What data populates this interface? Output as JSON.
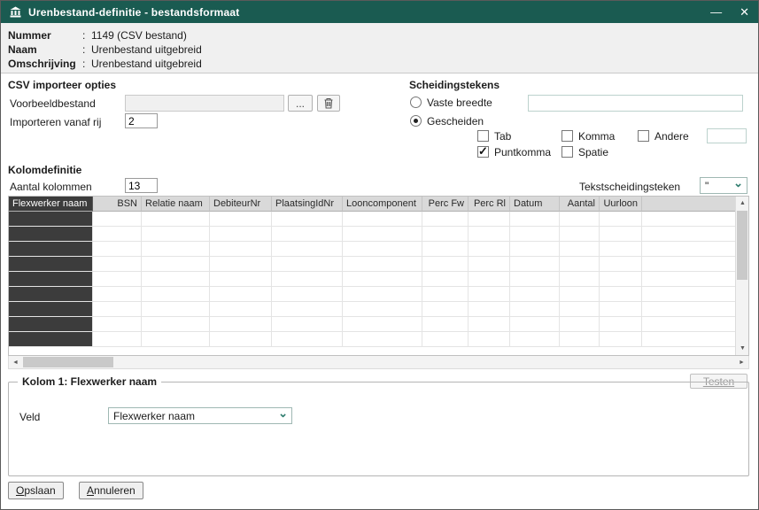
{
  "colors": {
    "titlebar": "#1a5b51",
    "accent": "#2e7d6e",
    "selected_column": "#3c3c3c"
  },
  "window": {
    "title": "Urenbestand-definitie - bestandsformaat"
  },
  "icons": {
    "minimize": "—",
    "close": "✕",
    "check": "✓",
    "chevron": "⌄",
    "scroll_up": "▲",
    "scroll_down": "▼",
    "scroll_left": "◄",
    "scroll_right": "►",
    "browse": "..."
  },
  "info": {
    "colon": ":",
    "rows": [
      {
        "label": "Nummer",
        "value": "1149 (CSV bestand)"
      },
      {
        "label": "Naam",
        "value": "Urenbestand uitgebreid"
      },
      {
        "label": "Omschrijving",
        "value": "Urenbestand uitgebreid"
      }
    ]
  },
  "csv_options": {
    "title": "CSV importeer opties",
    "sample_file_label": "Voorbeeldbestand",
    "sample_file_value": "",
    "import_from_row_label": "Importeren vanaf rij",
    "import_from_row_value": "2"
  },
  "delimiters": {
    "title": "Scheidingstekens",
    "fixed_width_label": "Vaste breedte",
    "fixed_width_value": "",
    "separated_label": "Gescheiden",
    "tab_label": "Tab",
    "comma_label": "Komma",
    "other_label": "Andere",
    "other_value": "",
    "semicolon_label": "Puntkomma",
    "space_label": "Spatie"
  },
  "column_definition": {
    "title": "Kolomdefinitie",
    "column_count_label": "Aantal kolommen",
    "column_count_value": "13",
    "text_delimiter_label": "Tekstscheidingsteken",
    "text_delimiter_value": "\""
  },
  "table": {
    "columns": [
      "Flexwerker naam",
      "BSN",
      "Relatie naam",
      "DebiteurNr",
      "PlaatsingIdNr",
      "Looncomponent",
      "Perc Fw",
      "Perc Rl",
      "Datum",
      "Aantal",
      "Uurloon"
    ],
    "row_count": 9
  },
  "column_editor": {
    "legend": "Kolom 1: Flexwerker naam",
    "test_label": "Testen",
    "field_label": "Veld",
    "field_value": "Flexwerker naam"
  },
  "footer": {
    "save_first": "O",
    "save_rest": "pslaan",
    "cancel_first": "A",
    "cancel_rest": "nnuleren"
  }
}
